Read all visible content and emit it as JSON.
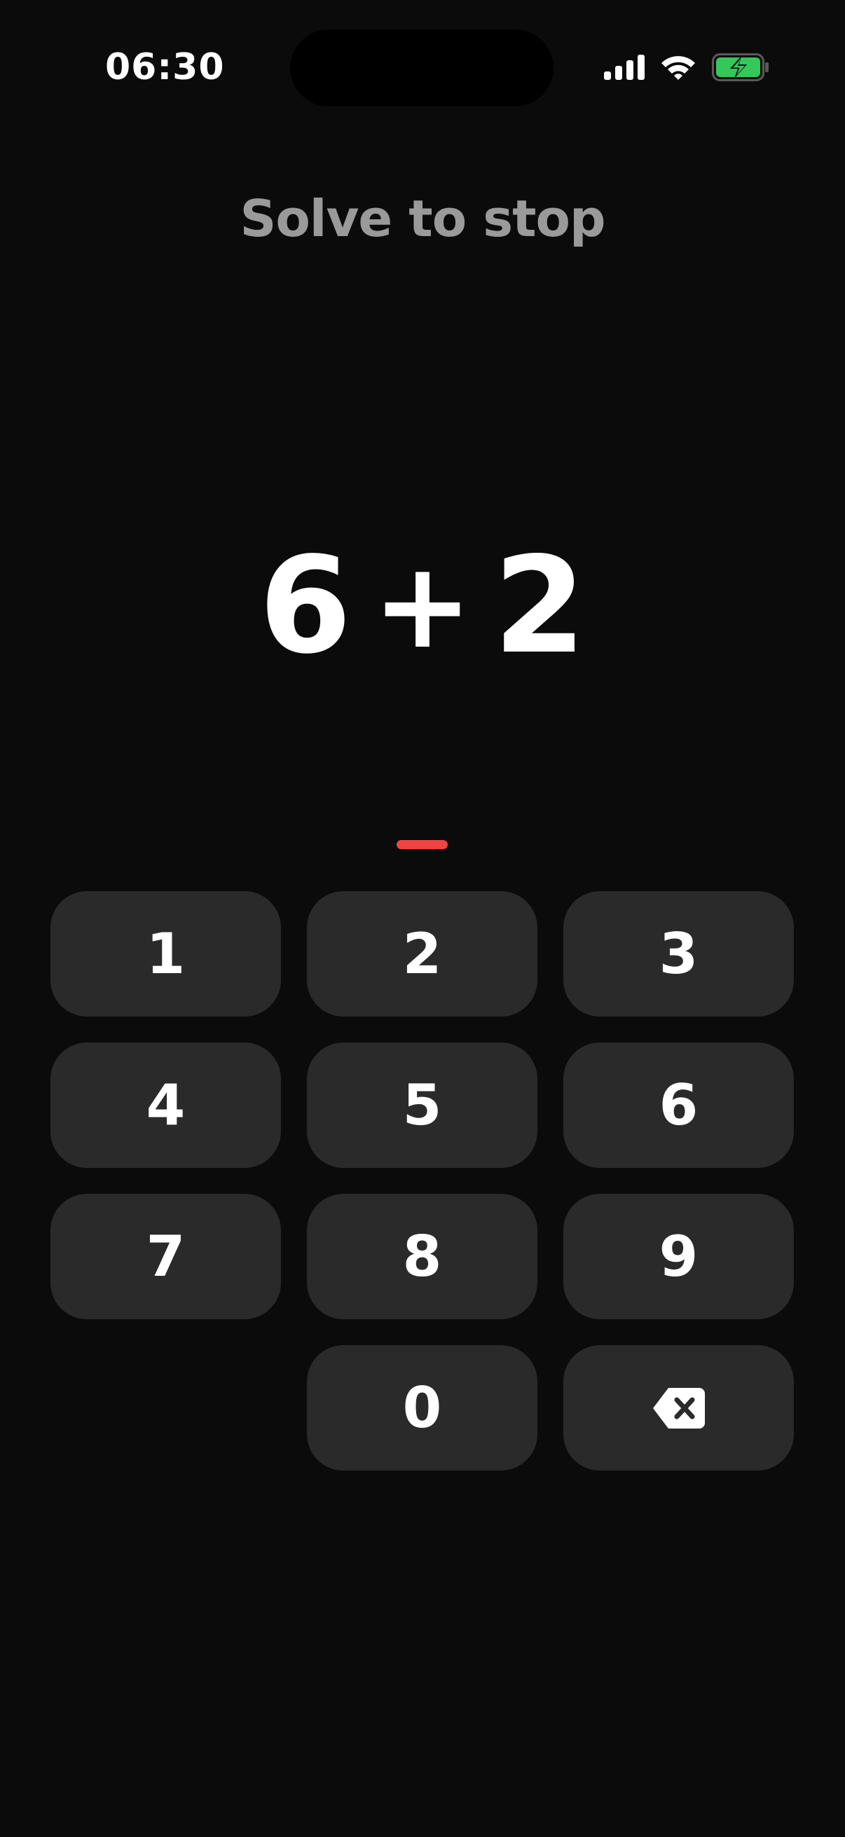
{
  "status_bar": {
    "time": "06:30",
    "icons": [
      "cellular-signal-icon",
      "wifi-icon",
      "battery-charging-icon"
    ],
    "battery_color": "#34c759"
  },
  "title": "Solve to stop",
  "equation": {
    "left": "6",
    "operator": "+",
    "right": "2"
  },
  "answer": {
    "value": "",
    "caret_color": "#ef4444"
  },
  "keypad": {
    "keys": [
      "1",
      "2",
      "3",
      "4",
      "5",
      "6",
      "7",
      "8",
      "9",
      "0"
    ],
    "backspace_icon": "backspace-icon"
  }
}
